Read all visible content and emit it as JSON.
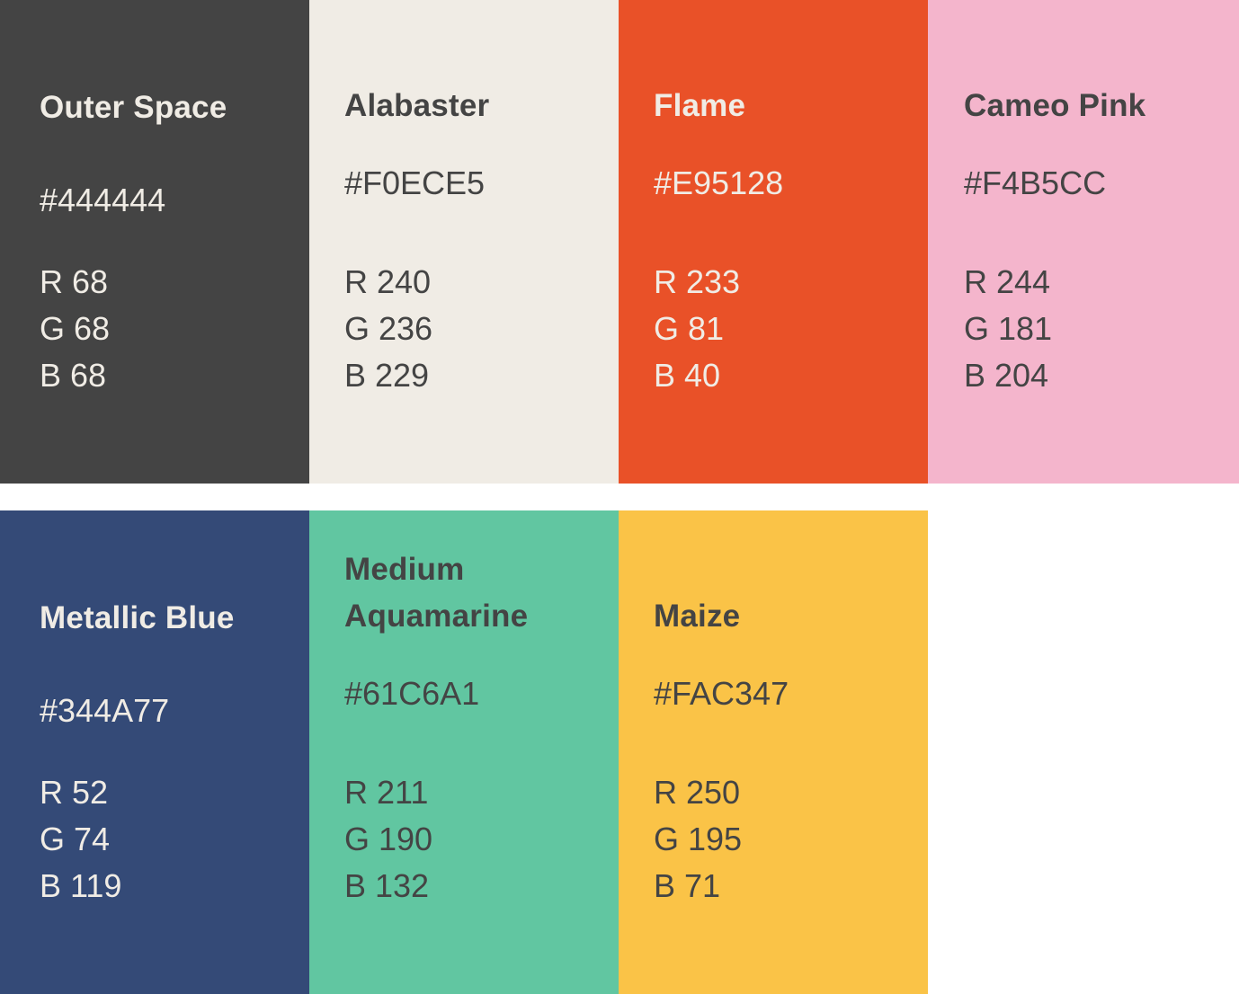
{
  "swatches": [
    {
      "name": "Outer Space",
      "hex": "#444444",
      "r": "R 68",
      "g": "G 68",
      "b": "B 68",
      "bg": "#444444",
      "text_color": "#F0ECE5"
    },
    {
      "name": "Alabaster",
      "hex": "#F0ECE5",
      "r": "R 240",
      "g": "G 236",
      "b": "B 229",
      "bg": "#F0ECE5",
      "text_color": "#444444"
    },
    {
      "name": "Flame",
      "hex": "#E95128",
      "r": "R 233",
      "g": "G 81",
      "b": "B 40",
      "bg": "#E95128",
      "text_color": "#F0ECE5"
    },
    {
      "name": "Cameo Pink",
      "hex": "#F4B5CC",
      "r": "R 244",
      "g": "G 181",
      "b": "B 204",
      "bg": "#F4B5CC",
      "text_color": "#444444"
    },
    {
      "name": "Metallic Blue",
      "hex": "#344A77",
      "r": "R 52",
      "g": "G 74",
      "b": "B 119",
      "bg": "#344A77",
      "text_color": "#F0ECE5"
    },
    {
      "name": "Medium Aquamarine",
      "hex": "#61C6A1",
      "r": "R 211",
      "g": "G 190",
      "b": "B 132",
      "bg": "#61C6A1",
      "text_color": "#444444"
    },
    {
      "name": "Maize",
      "hex": "#FAC347",
      "r": "R 250",
      "g": "G 195",
      "b": "B 71",
      "bg": "#FAC347",
      "text_color": "#444444"
    }
  ]
}
